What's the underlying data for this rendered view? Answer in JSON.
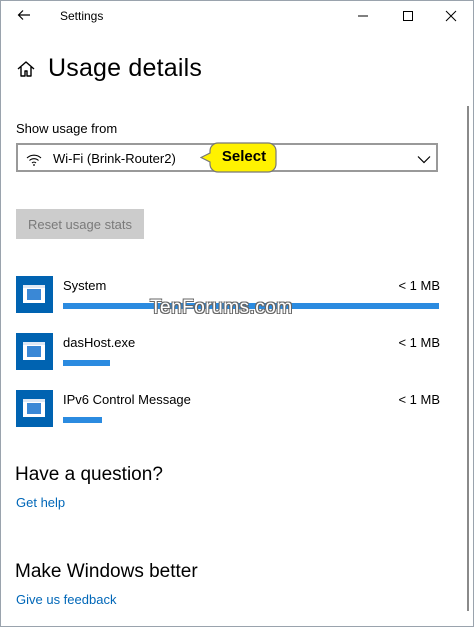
{
  "window": {
    "title": "Settings"
  },
  "header": {
    "title": "Usage details"
  },
  "show_usage": {
    "label": "Show usage from",
    "selected": "Wi-Fi (Brink-Router2)"
  },
  "callout": {
    "text": "Select"
  },
  "reset_button": {
    "label": "Reset usage stats"
  },
  "apps": [
    {
      "name": "System",
      "usage": "< 1 MB",
      "bar_fraction": 1.0
    },
    {
      "name": "dasHost.exe",
      "usage": "< 1 MB",
      "bar_fraction": 0.125
    },
    {
      "name": "IPv6 Control Message",
      "usage": "< 1 MB",
      "bar_fraction": 0.105
    }
  ],
  "watermark": "TenForums.com",
  "question": {
    "heading": "Have a question?",
    "link": "Get help"
  },
  "feedback": {
    "heading": "Make Windows better",
    "link": "Give us feedback"
  },
  "colors": {
    "accent": "#0063b1",
    "link": "#0067b8",
    "bar": "#2b8be0",
    "callout": "#fff200"
  }
}
